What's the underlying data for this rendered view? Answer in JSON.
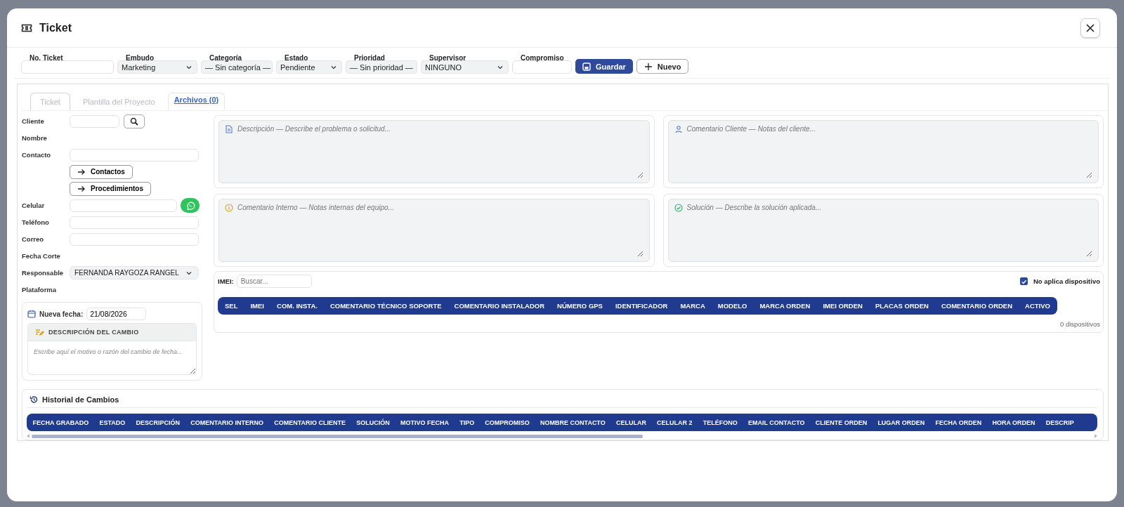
{
  "window": {
    "title": "Ticket"
  },
  "toolbar": {
    "fields": [
      {
        "kind": "input",
        "label": "No. Ticket"
      },
      {
        "kind": "select",
        "label": "Embudo",
        "value": "Marketing"
      },
      {
        "kind": "select",
        "label": "Categoría",
        "value": "— Sin categoría —"
      },
      {
        "kind": "select",
        "label": "Estado",
        "value": "Pendiente"
      },
      {
        "kind": "select",
        "label": "Prioridad",
        "value": "— Sin prioridad —"
      },
      {
        "kind": "select",
        "label": "Supervisor",
        "value": "NINGUNO"
      },
      {
        "kind": "input",
        "label": "Compromiso"
      }
    ],
    "buttons": [
      {
        "kind": "primary",
        "label": "Guardar"
      },
      {
        "kind": "secondary",
        "label": "Nuevo"
      }
    ]
  },
  "tabs": [
    {
      "label": "Ticket",
      "selected": true,
      "kind": "tab"
    },
    {
      "label": "Plantilla del Proyecto",
      "selected": false,
      "kind": "tab"
    },
    {
      "label": "Archivos (0)",
      "selected": false,
      "kind": "link"
    }
  ],
  "form": {
    "rows": [
      {
        "kind": "search",
        "label": "Cliente"
      },
      {
        "kind": "label",
        "label": "Nombre"
      },
      {
        "kind": "input",
        "label": "Contacto"
      },
      {
        "kind": "link_button",
        "label": "Contactos"
      },
      {
        "kind": "link_button",
        "label": "Procedimientos"
      },
      {
        "kind": "whatsapp",
        "label": "Celular"
      },
      {
        "kind": "input",
        "label": "Teléfono"
      },
      {
        "kind": "input",
        "label": "Correo"
      },
      {
        "kind": "label",
        "label": "Fecha Corte"
      },
      {
        "kind": "select",
        "label": "Responsable",
        "value": "FERNANDA RAYGOZA RANGEL"
      },
      {
        "kind": "label",
        "label": "Plataforma"
      }
    ],
    "date_change": {
      "label": "Nueva fecha:",
      "value": "21/08/2026",
      "heading": "DESCRIPCIÓN DEL CAMBIO",
      "placeholder": "Escribe aquí el motivo o razón del cambio de fecha..."
    }
  },
  "notes": [
    {
      "kind": "document",
      "placeholder": "Descripción — Describe el problema o solicitud..."
    },
    {
      "kind": "person",
      "placeholder": "Comentario Cliente — Notas del cliente..."
    },
    {
      "kind": "info",
      "placeholder": "Comentario Interno — Notas internas del equipo..."
    },
    {
      "kind": "check",
      "placeholder": "Solución — Describe la solución aplicada..."
    }
  ],
  "devices": {
    "search_label": "IMEI:",
    "search_placeholder": "Buscar...",
    "no_device": {
      "label": "No aplica dispositivo",
      "checked": true
    },
    "columns": [
      "SEL",
      "IMEI",
      "COM. INSTA.",
      "COMENTARIO TÉCNICO SOPORTE",
      "COMENTARIO INSTALADOR",
      "NÚMERO GPS",
      "IDENTIFICADOR",
      "MARCA",
      "MODELO",
      "MARCA ORDEN",
      "IMEI ORDEN",
      "PLACAS ORDEN",
      "COMENTARIO ORDEN",
      "ACTIVO"
    ],
    "count": "0 dispositivos"
  },
  "history": {
    "title": "Historial de Cambios",
    "columns": [
      "FECHA GRABADO",
      "ESTADO",
      "DESCRIPCIÓN",
      "COMENTARIO INTERNO",
      "COMENTARIO CLIENTE",
      "SOLUCIÓN",
      "MOTIVO FECHA",
      "TIPO",
      "COMPROMISO",
      "NOMBRE CONTACTO",
      "CELULAR",
      "CELULAR 2",
      "TELÉFONO",
      "EMAIL CONTACTO",
      "CLIENTE ORDEN",
      "LUGAR ORDEN",
      "FECHA ORDEN",
      "HORA ORDEN",
      "DESCRIP"
    ]
  }
}
